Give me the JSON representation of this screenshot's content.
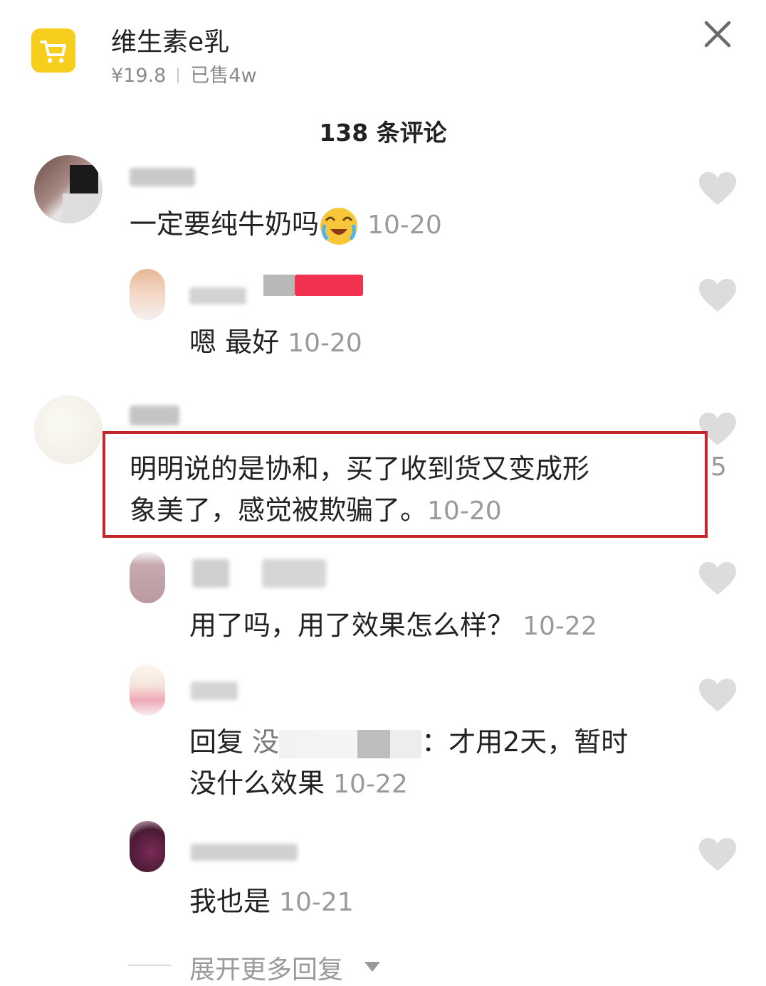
{
  "header": {
    "product_name": "维生素e乳",
    "price": "¥19.8",
    "sold": "已售4w",
    "accent_color": "#f7cd1e"
  },
  "comment_count": "138 条评论",
  "comments": [
    {
      "text": "一定要纯牛奶吗",
      "emoji": "crying-laughing-emoji",
      "time": "10-20"
    },
    {
      "text": "嗯 最好",
      "time": "10-20"
    },
    {
      "line1": "明明说的是协和，买了收到货又变成形",
      "line2": "象美了，感觉被欺骗了。",
      "time": "10-20",
      "like_count_fragment": "5",
      "highlight_color": "#c4272b"
    },
    {
      "text": "用了吗，用了效果怎么样？",
      "time": "10-22"
    },
    {
      "line1_prefix": "回复",
      "line1_partial": "没",
      "line1_suffix": "：才用2天，暂时",
      "line2": "没什么效果",
      "time": "10-22"
    },
    {
      "text": "我也是",
      "time": "10-21"
    }
  ],
  "expand_replies": "展开更多回复",
  "icons": [
    "shopping-cart-icon",
    "close-icon",
    "heart-icon",
    "caret-down-icon"
  ]
}
